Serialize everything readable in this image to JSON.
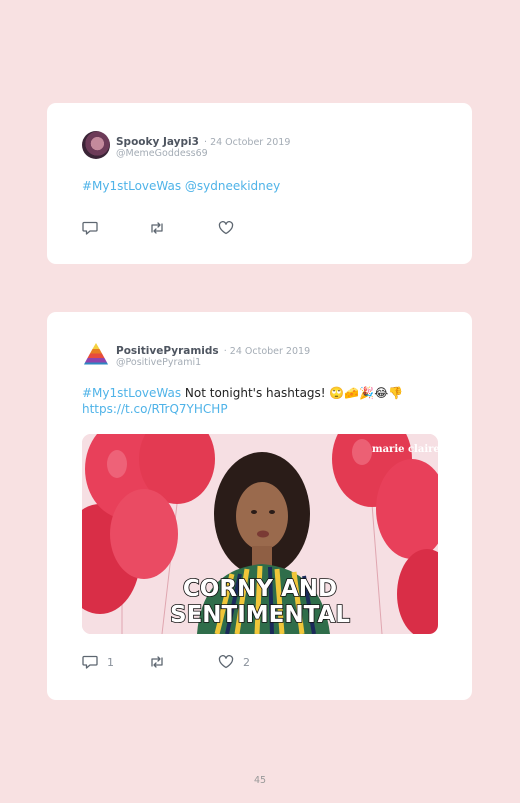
{
  "tweets": [
    {
      "display_name": "Spooky Jaypi3",
      "date": "· 24 October 2019",
      "handle": "@MemeGoddess69",
      "text_link": "#My1stLoveWas @sydneekidney",
      "avatar": "avatar-photo"
    },
    {
      "display_name": "PositivePyramids",
      "date": "· 24 October 2019",
      "handle": "@PositivePyrami1",
      "text_hashtag": "#My1stLoveWas",
      "text_body": " Not tonight's hashtags! 🙄🧀🎉😂👎",
      "text_url": "https://t.co/RTrQ7YHCHP",
      "media": {
        "watermark": "marie claire",
        "caption_line1": "CORNY AND",
        "caption_line2": "SENTIMENTAL"
      },
      "reply_count": "1",
      "like_count": "2",
      "avatar": "pyramid-logo"
    }
  ],
  "icons": {
    "reply": "reply-icon",
    "retweet": "retweet-icon",
    "like": "heart-icon"
  },
  "colors": {
    "background": "#f8e1e2",
    "link": "#4fb3e8",
    "balloon": "#e6384f"
  },
  "page_number": "45"
}
